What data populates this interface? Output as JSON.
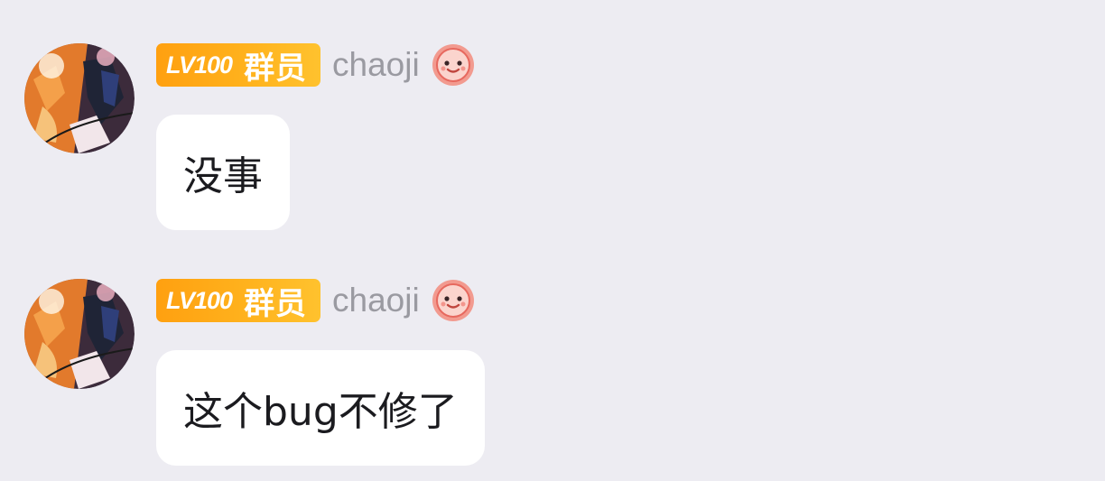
{
  "messages": [
    {
      "level_badge": "LV100",
      "role": "群员",
      "nickname": "chaoji",
      "title_icon": "smiling-face-icon",
      "text": "没事"
    },
    {
      "level_badge": "LV100",
      "role": "群员",
      "nickname": "chaoji",
      "title_icon": "smiling-face-icon",
      "text": "这个bug不修了"
    }
  ],
  "colors": {
    "background": "#edecf2",
    "badge_gradient_start": "#ffa010",
    "badge_gradient_end": "#ffc22e",
    "nickname": "#9a9aa1",
    "bubble": "#ffffff",
    "message_text": "#1b1b1f"
  }
}
